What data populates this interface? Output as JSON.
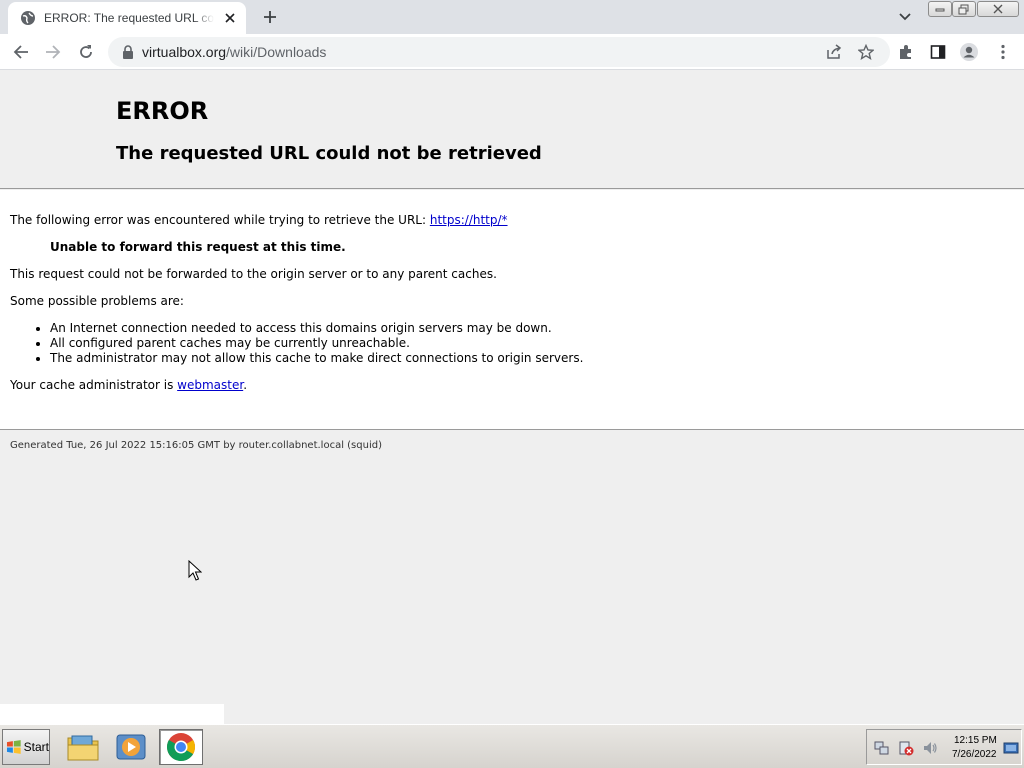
{
  "browser": {
    "tab_title": "ERROR: The requested URL could not be retrieved",
    "url_host": "virtualbox.org",
    "url_path": "/wiki/Downloads"
  },
  "page": {
    "heading": "ERROR",
    "subheading": "The requested URL could not be retrieved",
    "intro_text": "The following error was encountered while trying to retrieve the URL: ",
    "intro_link": "https://http/*",
    "error_detail": "Unable to forward this request at this time.",
    "explanation": "This request could not be forwarded to the origin server or to any parent caches.",
    "problems_intro": "Some possible problems are:",
    "problems": [
      "An Internet connection needed to access this domains origin servers may be down.",
      "All configured parent caches may be currently unreachable.",
      "The administrator may not allow this cache to make direct connections to origin servers."
    ],
    "admin_text": "Your cache administrator is ",
    "admin_link": "webmaster",
    "admin_suffix": ".",
    "generated": "Generated Tue, 26 Jul 2022 15:16:05 GMT by router.collabnet.local (squid)"
  },
  "taskbar": {
    "start_label": "Start",
    "clock_time": "12:15 PM",
    "clock_date": "7/26/2022"
  }
}
